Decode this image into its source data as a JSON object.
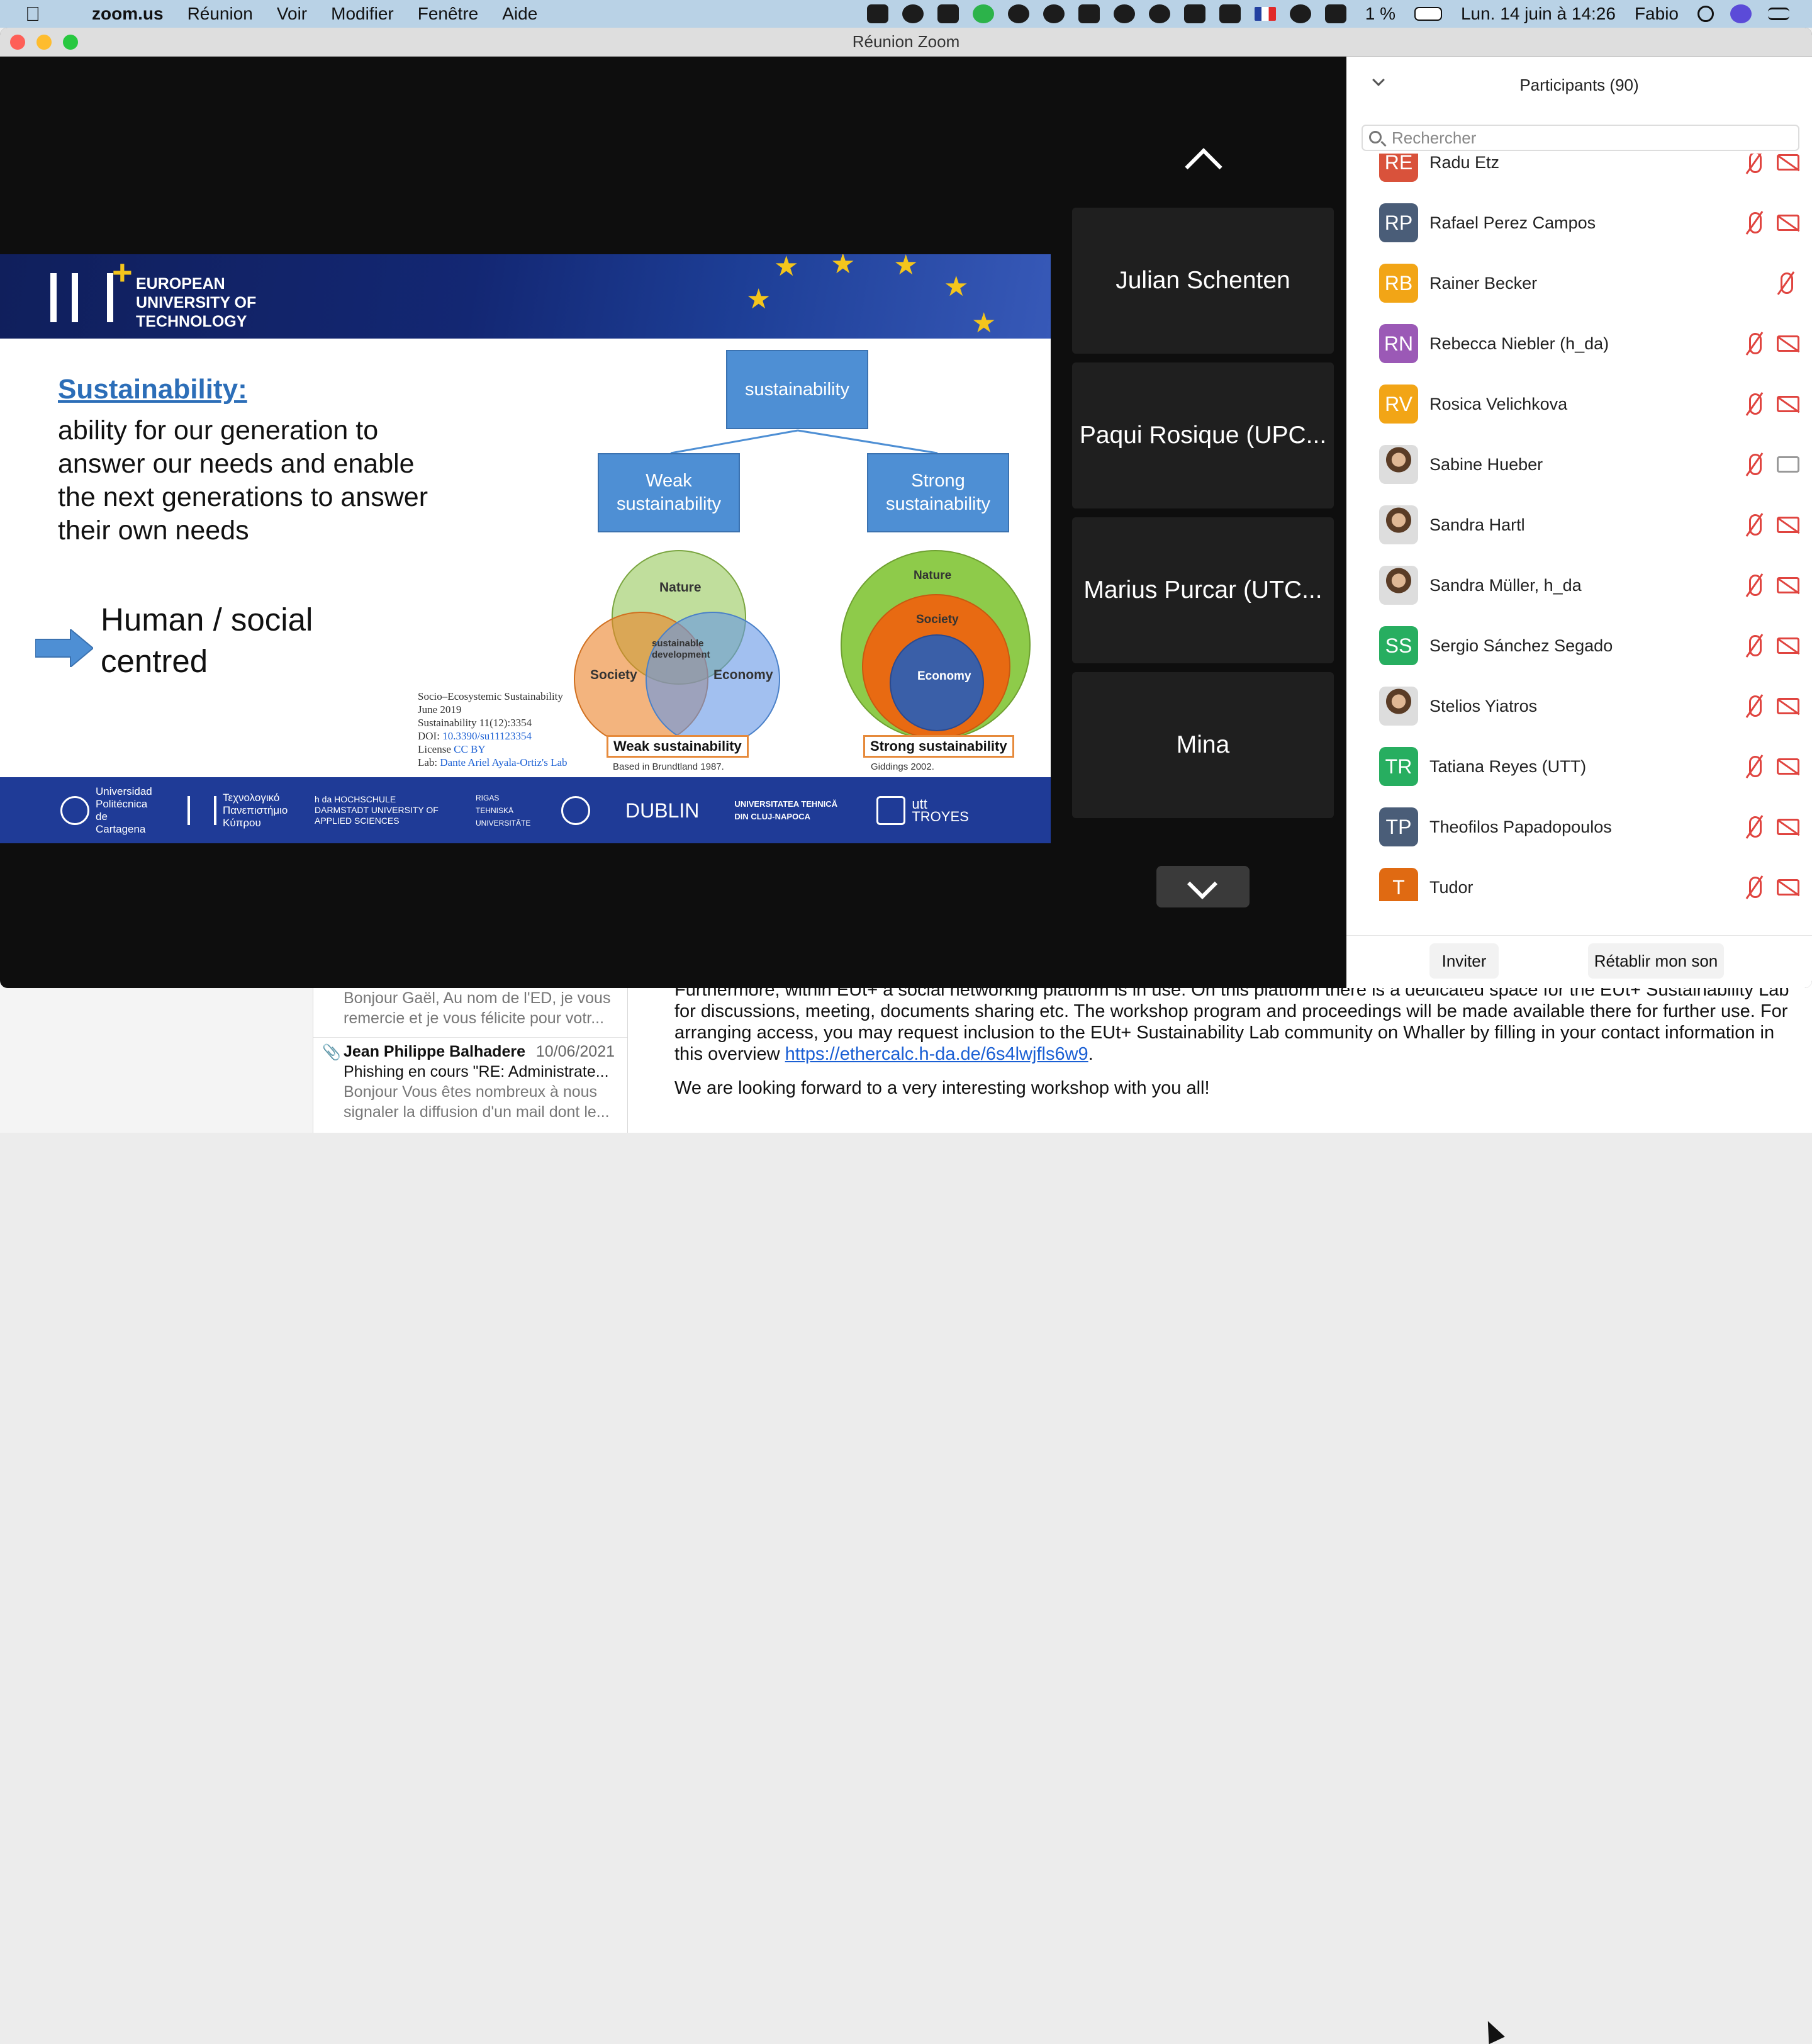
{
  "menubar": {
    "app": "zoom.us",
    "menus": [
      "Réunion",
      "Voir",
      "Modifier",
      "Fenêtre",
      "Aide"
    ],
    "battery": "1 %",
    "datetime": "Lun. 14 juin à 14:26",
    "user": "Fabio"
  },
  "window": {
    "title": "Réunion Zoom"
  },
  "slide": {
    "brand_line1": "EUROPEAN",
    "brand_line2": "UNIVERSITY OF",
    "brand_line3": "TECHNOLOGY",
    "title": "Sustainability:",
    "definition": "ability for our generation to answer our needs and enable the next generations to answer their own needs",
    "highlight": "Human / social centred",
    "box_top": "sustainability",
    "box_weak": "Weak sustainability",
    "box_strong": "Strong sustainability",
    "venn_nature": "Nature",
    "venn_society": "Society",
    "venn_economy": "Economy",
    "venn_center": "sustainable development",
    "weak_label": "Weak sustainability",
    "weak_cite": "Based in Brundtland 1987.",
    "strong_label": "Strong sustainability",
    "strong_cite": "Giddings 2002.",
    "ref1": "Socio–Ecosystemic Sustainability",
    "ref2": "June 2019",
    "ref3": "Sustainability 11(12):3354",
    "ref4_label": "DOI: ",
    "ref4_link": "10.3390/su11123354",
    "ref5_label": "License ",
    "ref5_link": "CC BY",
    "ref6_label": "Lab: ",
    "ref6_link": "Dante Ariel Ayala-Ortiz's Lab",
    "partners": [
      "Universidad Politécnica de Cartagena",
      "Τεχνολογικό Πανεπιστήμιο Κύπρου",
      "h da HOCHSCHULE DARMSTADT UNIVERSITY OF APPLIED SCIENCES",
      "RIGAS TEHNISKĀ UNIVERSITĀTE",
      "",
      "DUBLIN",
      "UNIVERSITATEA TEHNICĂ DIN CLUJ-NAPOCA",
      "utt TROYES"
    ]
  },
  "tiles": [
    "Julian Schenten",
    "Paqui Rosique (UPC...",
    "Marius Purcar (UTC...",
    "Mina"
  ],
  "participants": {
    "header": "Participants (90)",
    "search_placeholder": "Rechercher",
    "list": [
      {
        "initials": "RE",
        "name": "Radu Etz",
        "color": "#d9523b",
        "photo": false,
        "mic_muted": true,
        "cam": "off"
      },
      {
        "initials": "RP",
        "name": "Rafael Perez Campos",
        "color": "#4a5d78",
        "photo": false,
        "mic_muted": true,
        "cam": "off"
      },
      {
        "initials": "RB",
        "name": "Rainer Becker",
        "color": "#f2a516",
        "photo": false,
        "mic_muted": true,
        "cam": "none"
      },
      {
        "initials": "RN",
        "name": "Rebecca Niebler (h_da)",
        "color": "#9b59b6",
        "photo": false,
        "mic_muted": true,
        "cam": "off"
      },
      {
        "initials": "RV",
        "name": "Rosica Velichkova",
        "color": "#f2a516",
        "photo": false,
        "mic_muted": true,
        "cam": "off"
      },
      {
        "initials": "",
        "name": "Sabine Hueber",
        "color": "#888",
        "photo": true,
        "mic_muted": true,
        "cam": "on"
      },
      {
        "initials": "",
        "name": "Sandra Hartl",
        "color": "#888",
        "photo": true,
        "mic_muted": true,
        "cam": "off"
      },
      {
        "initials": "",
        "name": "Sandra Müller, h_da",
        "color": "#888",
        "photo": true,
        "mic_muted": true,
        "cam": "off"
      },
      {
        "initials": "SS",
        "name": "Sergio Sánchez Segado",
        "color": "#27ae60",
        "photo": false,
        "mic_muted": true,
        "cam": "off"
      },
      {
        "initials": "",
        "name": "Stelios Yiatros",
        "color": "#888",
        "photo": true,
        "mic_muted": true,
        "cam": "off"
      },
      {
        "initials": "TR",
        "name": "Tatiana Reyes (UTT)",
        "color": "#27ae60",
        "photo": false,
        "mic_muted": true,
        "cam": "off"
      },
      {
        "initials": "TP",
        "name": "Theofilos Papadopoulos",
        "color": "#4a5d78",
        "photo": false,
        "mic_muted": true,
        "cam": "off"
      },
      {
        "initials": "T",
        "name": "Tudor",
        "color": "#e06a12",
        "photo": false,
        "mic_muted": true,
        "cam": "off"
      }
    ],
    "invite": "Inviter",
    "unmute": "Rétablir mon son"
  },
  "mail": {
    "items": [
      {
        "from": "",
        "date": "",
        "subject": "",
        "preview": "Bonjour Gaël, Au nom de l'ED, je vous remercie et je vous félicite pour votr..."
      },
      {
        "from": "Jean Philippe Balhadere",
        "date": "10/06/2021",
        "subject": "Phishing en cours \"RE: Administrate...",
        "preview": "Bonjour Vous êtes nombreux à nous signaler la diffusion d'un mail dont le..."
      }
    ],
    "body_p1": "Furthermore, within EUt+ a social networking platform is in use. On this platform there is a dedicated space for the EUt+ Sustainability Lab for discussions, meeting, documents sharing etc. The workshop program and proceedings will be made available there for further use. For arranging access, you may request inclusion to the EUt+ Sustainability Lab community on Whaller by filling in your contact information in this overview ",
    "body_link": "https://ethercalc.h-da.de/6s4lwjfls6w9",
    "body_p1_end": ".",
    "body_p2": "We are looking forward to a very interesting workshop with you all!"
  }
}
